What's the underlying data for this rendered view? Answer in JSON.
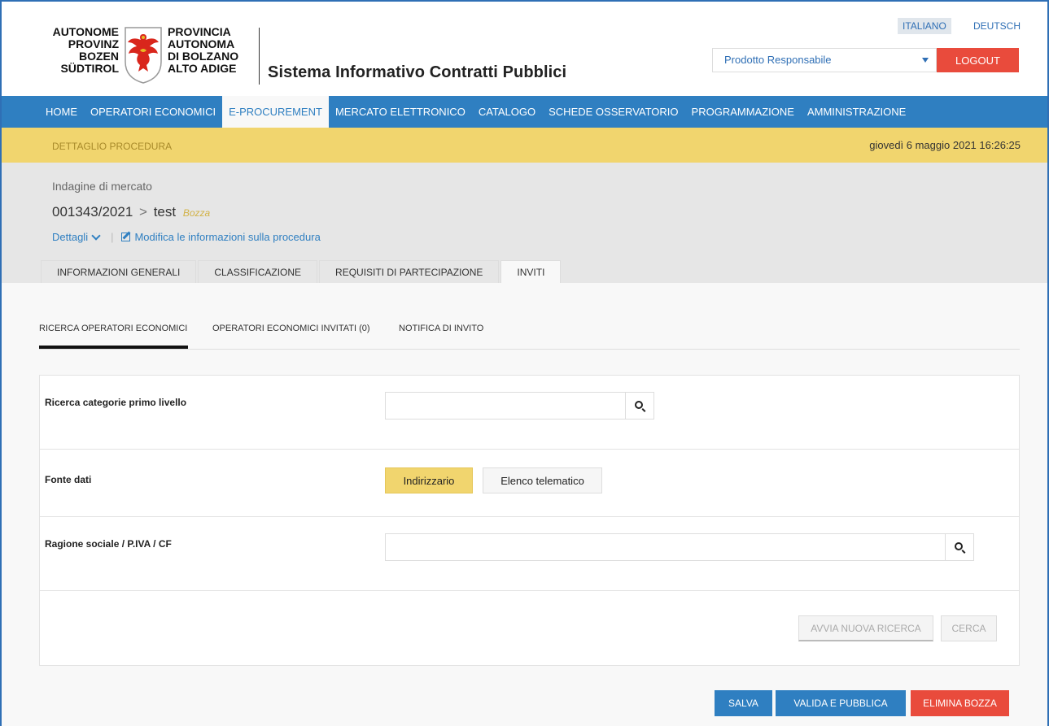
{
  "header": {
    "logo_left_lines": [
      "AUTONOME",
      "PROVINZ",
      "BOZEN",
      "SÜDTIROL"
    ],
    "logo_right_lines": [
      "PROVINCIA",
      "AUTONOMA",
      "DI BOLZANO",
      "ALTO ADIGE"
    ],
    "app_title": "Sistema Informativo Contratti Pubblici",
    "languages": {
      "italian": "ITALIANO",
      "german": "DEUTSCH",
      "active": "italian"
    },
    "role_select": "Prodotto Responsabile",
    "logout_label": "LOGOUT"
  },
  "nav": {
    "items": [
      "HOME",
      "OPERATORI ECONOMICI",
      "E-PROCUREMENT",
      "MERCATO ELETTRONICO",
      "CATALOGO",
      "SCHEDE OSSERVATORIO",
      "PROGRAMMAZIONE",
      "AMMINISTRAZIONE"
    ],
    "active": "E-PROCUREMENT"
  },
  "subbar": {
    "title": "DETTAGLIO PROCEDURA",
    "datetime": "giovedì 6 maggio 2021 16:26:25"
  },
  "procedure": {
    "type": "Indagine di mercato",
    "id": "001343/2021",
    "separator": ">",
    "name": "test",
    "status": "Bozza",
    "details_link": "Dettagli",
    "edit_link": "Modifica le informazioni sulla procedura"
  },
  "tabs": {
    "items": [
      "INFORMAZIONI GENERALI",
      "CLASSIFICAZIONE",
      "REQUISITI DI PARTECIPAZIONE",
      "INVITI"
    ],
    "active": "INVITI"
  },
  "subtabs": {
    "items": [
      "RICERCA OPERATORI ECONOMICI",
      "OPERATORI ECONOMICI INVITATI (0)",
      "NOTIFICA DI INVITO"
    ],
    "active": "RICERCA OPERATORI ECONOMICI"
  },
  "form": {
    "category_search": {
      "label": "Ricerca categorie primo livello",
      "value": ""
    },
    "data_source": {
      "label": "Fonte dati",
      "options": [
        "Indirizzario",
        "Elenco telematico"
      ],
      "selected": "Indirizzario"
    },
    "company_search": {
      "label": "Ragione sociale / P.IVA / CF",
      "value": ""
    },
    "new_search_label": "AVVIA NUOVA RICERCA",
    "search_label": "CERCA"
  },
  "actions": {
    "save": "SALVA",
    "validate_publish": "VALIDA E PUBBLICA",
    "delete_draft": "ELIMINA BOZZA"
  },
  "colors": {
    "brand_blue": "#2f7fc1",
    "accent_yellow": "#f1d56e",
    "danger_red": "#e94b3c"
  }
}
